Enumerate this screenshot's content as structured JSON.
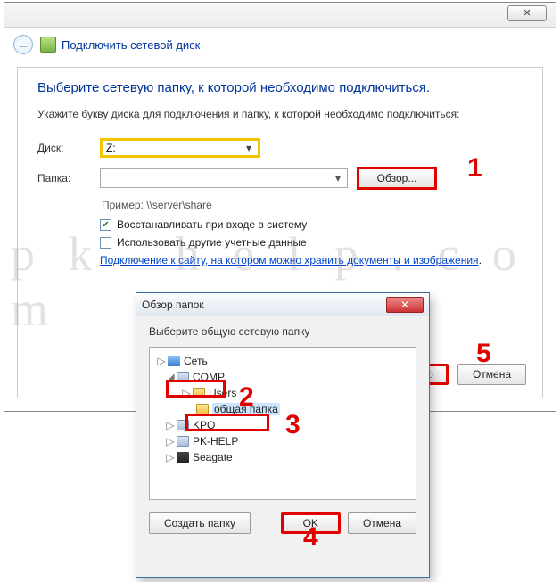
{
  "window": {
    "title": "Подключить сетевой диск"
  },
  "wizard": {
    "heading": "Выберите сетевую папку, к которой необходимо подключиться.",
    "instruction": "Укажите букву диска для подключения и папку, к которой необходимо подключиться:",
    "drive_label": "Диск:",
    "drive_value": "Z:",
    "folder_label": "Папка:",
    "folder_value": "",
    "browse_label": "Обзор...",
    "example": "Пример: \\\\server\\share",
    "reconnect_label": "Восстанавливать при входе в систему",
    "reconnect_checked": true,
    "othercreds_label": "Использовать другие учетные данные",
    "othercreds_checked": false,
    "link_text": "Подключение к сайту, на котором можно хранить документы и изображения",
    "ready_label": "Готово",
    "cancel_label": "Отмена"
  },
  "browse": {
    "title": "Обзор папок",
    "subtitle": "Выберите общую сетевую папку",
    "tree": {
      "network": "Сеть",
      "comp": "COMP",
      "users": "Users",
      "shared": "общая папка",
      "kpo": "KPO",
      "pkhelp": "PK-HELP",
      "seagate": "Seagate"
    },
    "create_label": "Создать папку",
    "ok_label": "OK",
    "cancel_label": "Отмена"
  },
  "annotations": {
    "n1": "1",
    "n2": "2",
    "n3": "3",
    "n4": "4",
    "n5": "5"
  },
  "watermark": "p k - h e l p . c o m"
}
